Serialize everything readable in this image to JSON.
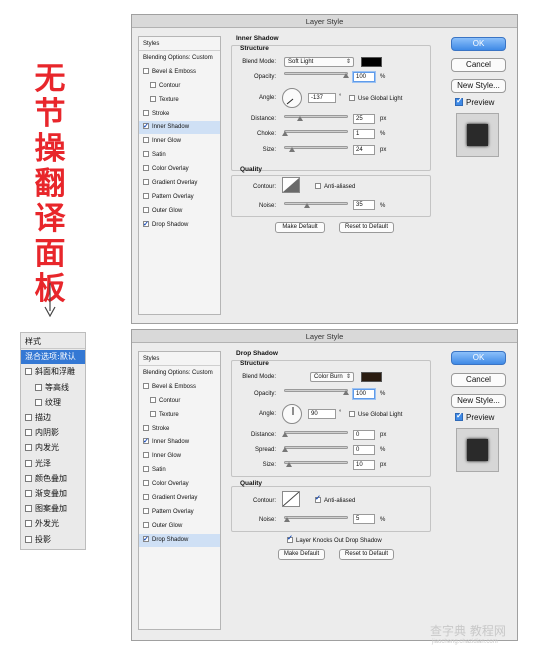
{
  "chinese_title": [
    "无",
    "节",
    "操",
    "翻",
    "译",
    "面",
    "板"
  ],
  "chinese_panel": {
    "rows": [
      "样式",
      "混合选项:默认",
      "斜面和浮雕",
      "等高线",
      "纹理",
      "描边",
      "内阴影",
      "内发光",
      "光泽",
      "颜色叠加",
      "渐变叠加",
      "图案叠加",
      "外发光",
      "投影"
    ]
  },
  "dialog1": {
    "title": "Layer Style",
    "styles": [
      {
        "label": "Styles",
        "checked": null
      },
      {
        "label": "Blending Options: Custom",
        "checked": null
      },
      {
        "label": "Bevel & Emboss",
        "checked": false
      },
      {
        "label": "Contour",
        "checked": false
      },
      {
        "label": "Texture",
        "checked": false
      },
      {
        "label": "Stroke",
        "checked": false
      },
      {
        "label": "Inner Shadow",
        "checked": true,
        "selected": true
      },
      {
        "label": "Inner Glow",
        "checked": false
      },
      {
        "label": "Satin",
        "checked": false
      },
      {
        "label": "Color Overlay",
        "checked": false
      },
      {
        "label": "Gradient Overlay",
        "checked": false
      },
      {
        "label": "Pattern Overlay",
        "checked": false
      },
      {
        "label": "Outer Glow",
        "checked": false
      },
      {
        "label": "Drop Shadow",
        "checked": true
      }
    ],
    "section_title": "Inner Shadow",
    "structure_title": "Structure",
    "blend_mode_label": "Blend Mode:",
    "blend_mode_value": "Soft Light",
    "blend_color": "#000000",
    "opacity_label": "Opacity:",
    "opacity_value": "100",
    "opacity_unit": "%",
    "angle_label": "Angle:",
    "angle_value": "-137",
    "angle_unit": "°",
    "use_global_light": "Use Global Light",
    "distance_label": "Distance:",
    "distance_value": "25",
    "distance_unit": "px",
    "choke_label": "Choke:",
    "choke_value": "1",
    "choke_unit": "%",
    "size_label": "Size:",
    "size_value": "24",
    "size_unit": "px",
    "quality_title": "Quality",
    "contour_label": "Contour:",
    "anti_aliased": "Anti-aliased",
    "noise_label": "Noise:",
    "noise_value": "35",
    "noise_unit": "%",
    "make_default": "Make Default",
    "reset_default": "Reset to Default",
    "ok": "OK",
    "cancel": "Cancel",
    "new_style": "New Style...",
    "preview": "Preview"
  },
  "dialog2": {
    "title": "Layer Style",
    "styles": [
      {
        "label": "Styles",
        "checked": null
      },
      {
        "label": "Blending Options: Custom",
        "checked": null
      },
      {
        "label": "Bevel & Emboss",
        "checked": false
      },
      {
        "label": "Contour",
        "checked": false
      },
      {
        "label": "Texture",
        "checked": false
      },
      {
        "label": "Stroke",
        "checked": false
      },
      {
        "label": "Inner Shadow",
        "checked": true
      },
      {
        "label": "Inner Glow",
        "checked": false
      },
      {
        "label": "Satin",
        "checked": false
      },
      {
        "label": "Color Overlay",
        "checked": false
      },
      {
        "label": "Gradient Overlay",
        "checked": false
      },
      {
        "label": "Pattern Overlay",
        "checked": false
      },
      {
        "label": "Outer Glow",
        "checked": false
      },
      {
        "label": "Drop Shadow",
        "checked": true,
        "selected": true
      }
    ],
    "section_title": "Drop Shadow",
    "structure_title": "Structure",
    "blend_mode_label": "Blend Mode:",
    "blend_mode_value": "Color Burn",
    "blend_color": "#2a1c10",
    "opacity_label": "Opacity:",
    "opacity_value": "100",
    "opacity_unit": "%",
    "angle_label": "Angle:",
    "angle_value": "90",
    "angle_unit": "°",
    "use_global_light": "Use Global Light",
    "distance_label": "Distance:",
    "distance_value": "0",
    "distance_unit": "px",
    "spread_label": "Spread:",
    "spread_value": "0",
    "spread_unit": "%",
    "size_label": "Size:",
    "size_value": "10",
    "size_unit": "px",
    "quality_title": "Quality",
    "contour_label": "Contour:",
    "anti_aliased": "Anti-aliased",
    "noise_label": "Noise:",
    "noise_value": "5",
    "noise_unit": "%",
    "knocks_out": "Layer Knocks Out Drop Shadow",
    "make_default": "Make Default",
    "reset_default": "Reset to Default",
    "ok": "OK",
    "cancel": "Cancel",
    "new_style": "New Style...",
    "preview": "Preview"
  },
  "watermark": "查字典 教程网",
  "watermark_url": "jiaocheng.chazidian.com"
}
